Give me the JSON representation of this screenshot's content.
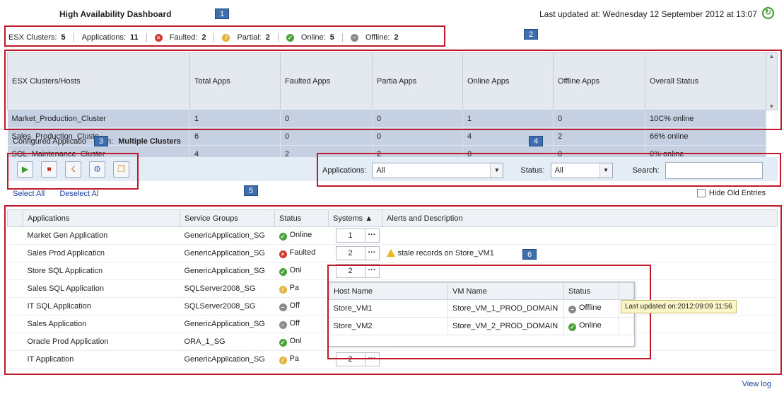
{
  "header": {
    "title": "High Availability Dashboard",
    "last_updated": "Last updated at: Wednesday 12 September 2012 at 13:07"
  },
  "callouts": [
    "1",
    "2",
    "3",
    "4",
    "5",
    "6"
  ],
  "summary": {
    "esx_label": "ESX Clusters:",
    "esx_value": "5",
    "apps_label": "Applications:",
    "apps_value": "11",
    "faulted_label": "Faulted:",
    "faulted_value": "2",
    "partial_label": "Partial:",
    "partial_value": "2",
    "online_label": "Online:",
    "online_value": "5",
    "offline_label": "Offline:",
    "offline_value": "2"
  },
  "clusters": {
    "headers": [
      "ESX Clusters/Hosts",
      "Total Apps",
      "Faulted Apps",
      "Partia Apps",
      "Online Apps",
      "Offline Apps",
      "Overall Status"
    ],
    "rows": [
      [
        "Market_Production_Cluster",
        "1",
        "0",
        "0",
        "1",
        "0",
        "10C% online"
      ],
      [
        "Sales_Production_Cluste",
        "6",
        "0",
        "0",
        "4",
        "2",
        "66% online"
      ],
      [
        "SQL_Maintenance_Cluster",
        "4",
        "2",
        "2",
        "0",
        "0",
        "0% online"
      ]
    ]
  },
  "configured": {
    "label": "Configured Applicatio",
    "label_end": "m:",
    "value": "Multiple Clusters"
  },
  "toolbar": {
    "icons": [
      "play-icon",
      "stop-icon",
      "clear-fault-icon",
      "manage-icon",
      "copy-icon"
    ]
  },
  "filters": {
    "applications_label": "Applications:",
    "applications_value": "All",
    "status_label": "Status:",
    "status_value": "All",
    "search_label": "Search:",
    "search_value": ""
  },
  "links": {
    "select_all": "Select All",
    "deselect_all": "Deselect Al"
  },
  "hide_old": "Hide Old Entries",
  "apps": {
    "headers": [
      "Applications",
      "Service Groups",
      "Status",
      "Systems ▲",
      "Alerts and Description"
    ],
    "rows": [
      {
        "name": "Market Gen Application",
        "sg": "GenericApplication_SG",
        "status": "Online",
        "status_type": "online",
        "systems": "1",
        "alert": ""
      },
      {
        "name": "Sales Prod Applicaticn",
        "sg": "GenericApplication_SG",
        "status": "Faulted",
        "status_type": "fault",
        "systems": "2",
        "alert": "stale records on Store_VM1"
      },
      {
        "name": "Store SQL Applicaticn",
        "sg": "GenericApplication_SG",
        "status": "Onl",
        "status_type": "online",
        "systems": "2",
        "alert": ""
      },
      {
        "name": "Sales SQL Application",
        "sg": "SQLServer2008_SG",
        "status": "Pa",
        "status_type": "partial",
        "systems": "",
        "alert": ""
      },
      {
        "name": "IT SQL Application",
        "sg": "SQLServer2008_SG",
        "status": "Off",
        "status_type": "offline",
        "systems": "",
        "alert": ""
      },
      {
        "name": "Sales Application",
        "sg": "GenericApplication_SG",
        "status": "Off",
        "status_type": "offline",
        "systems": "",
        "alert": ""
      },
      {
        "name": "Oracle Prod Application",
        "sg": "ORA_1_SG",
        "status": "Onl",
        "status_type": "online",
        "systems": "",
        "alert": ""
      },
      {
        "name": "IT Application",
        "sg": "GenericApplication_SG",
        "status": "Pa",
        "status_type": "partial",
        "systems": "2",
        "alert": ""
      }
    ]
  },
  "popup": {
    "headers": [
      "Host Name",
      "VM Name",
      "Status"
    ],
    "rows": [
      {
        "host": "Store_VM1",
        "vm": "Store_VM_1_PROD_DOMAIN",
        "status": "Offline",
        "status_type": "offline"
      },
      {
        "host": "Store_VM2",
        "vm": "Store_VM_2_PROD_DOMAIN",
        "status": "Online",
        "status_type": "online"
      }
    ]
  },
  "tooltip": "Last updated on:2012:09:09 11:56",
  "footer": {
    "view_log": "View log"
  },
  "colors": {
    "annotation_red": "#c0192b",
    "callout_blue": "#3d6fae",
    "selected_row": "#c6d0e3"
  }
}
